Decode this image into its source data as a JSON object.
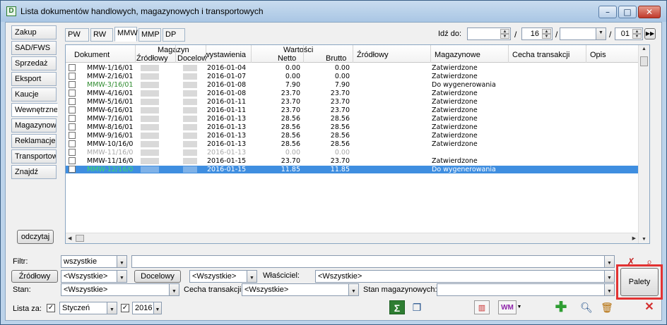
{
  "window": {
    "title": "Lista dokumentów handlowych, magazynowych i transportowych",
    "app_icon": "D"
  },
  "sidebar": {
    "items": [
      {
        "label": "Zakup"
      },
      {
        "label": "SAD/FWS"
      },
      {
        "label": "Sprzedaż"
      },
      {
        "label": "Eksport"
      },
      {
        "label": "Kaucje"
      },
      {
        "label": "Wewnętrzne"
      },
      {
        "label": "Magazynowe"
      },
      {
        "label": "Reklamacje"
      },
      {
        "label": "Transportowe"
      },
      {
        "label": "Znajdź"
      }
    ],
    "refresh_label": "odczytaj"
  },
  "tabs": [
    {
      "label": "PW"
    },
    {
      "label": "RW"
    },
    {
      "label": "MMW"
    },
    {
      "label": "MMP"
    },
    {
      "label": "DP"
    }
  ],
  "navigation": {
    "label": "Idź do:",
    "day_value": "16",
    "page_value": "01",
    "separator": "/"
  },
  "grid": {
    "headers": {
      "dokument": "Dokument",
      "magazyn_group": "Magazyn",
      "zrodlowy": "Źródłowy",
      "docelowy": "Docelow",
      "data": "Data wystawienia",
      "wartosci_group": "Wartości",
      "netto": "Netto",
      "brutto": "Brutto",
      "zrodlowy2": "Źródłowy",
      "magazynowe": "Magazynowe",
      "cecha": "Cecha transakcji",
      "opis": "Opis"
    },
    "rows": [
      {
        "doc": "MMW-1/16/01",
        "date": "2016-01-04",
        "netto": "0.00",
        "brutto": "0.00",
        "status": "Zatwierdzone",
        "color": "#000000"
      },
      {
        "doc": "MMW-2/16/01",
        "date": "2016-01-07",
        "netto": "0.00",
        "brutto": "0.00",
        "status": "Zatwierdzone",
        "color": "#000000"
      },
      {
        "doc": "MMW-3/16/01",
        "date": "2016-01-08",
        "netto": "7.90",
        "brutto": "7.90",
        "status": "Do wygenerowania",
        "color": "#2e8b2e"
      },
      {
        "doc": "MMW-4/16/01",
        "date": "2016-01-08",
        "netto": "23.70",
        "brutto": "23.70",
        "status": "Zatwierdzone",
        "color": "#000000"
      },
      {
        "doc": "MMW-5/16/01",
        "date": "2016-01-11",
        "netto": "23.70",
        "brutto": "23.70",
        "status": "Zatwierdzone",
        "color": "#000000"
      },
      {
        "doc": "MMW-6/16/01",
        "date": "2016-01-11",
        "netto": "23.70",
        "brutto": "23.70",
        "status": "Zatwierdzone",
        "color": "#000000"
      },
      {
        "doc": "MMW-7/16/01",
        "date": "2016-01-13",
        "netto": "28.56",
        "brutto": "28.56",
        "status": "Zatwierdzone",
        "color": "#000000"
      },
      {
        "doc": "MMW-8/16/01",
        "date": "2016-01-13",
        "netto": "28.56",
        "brutto": "28.56",
        "status": "Zatwierdzone",
        "color": "#000000"
      },
      {
        "doc": "MMW-9/16/01",
        "date": "2016-01-13",
        "netto": "28.56",
        "brutto": "28.56",
        "status": "Zatwierdzone",
        "color": "#000000"
      },
      {
        "doc": "MMW-10/16/01",
        "date": "2016-01-13",
        "netto": "28.56",
        "brutto": "28.56",
        "status": "Zatwierdzone",
        "color": "#000000"
      },
      {
        "doc": "MMW-11/16/01",
        "date": "2016-01-13",
        "netto": "0.00",
        "brutto": "0.00",
        "status": "",
        "color": "#a8a8a8"
      },
      {
        "doc": "MMW-11/16/01",
        "date": "2016-01-15",
        "netto": "23.70",
        "brutto": "23.70",
        "status": "Zatwierdzone",
        "color": "#000000"
      },
      {
        "doc": "MMW-12/16/01",
        "date": "2016-01-15",
        "netto": "11.85",
        "brutto": "11.85",
        "status": "Do wygenerowania",
        "color": "#3ddc6e",
        "selected": true
      }
    ]
  },
  "filters": {
    "filtr_label": "Filtr:",
    "filtr_value": "wszystkie",
    "zrodlowy_button": "Źródłowy",
    "zrodlowy_value": "<Wszystkie>",
    "docelowy_button": "Docelowy",
    "docelowy_value": "<Wszystkie>",
    "wlasciciel_label": "Właściciel:",
    "wlasciciel_value": "<Wszystkie>",
    "stan_label": "Stan:",
    "stan_value": "<Wszystkie>",
    "cecha_label": "Cecha transakcji:",
    "cecha_value": "<Wszystkie>",
    "stan_mag_label": "Stan magazynowych:",
    "stan_mag_value": "",
    "lista_label": "Lista za:",
    "month_value": "Styczeń",
    "year_value": "2016",
    "palety_button": "Palety"
  },
  "toolbar": {
    "sum_icon": "Σ",
    "wm_label": "WM"
  },
  "colors": {
    "selection": "#3f8ee0",
    "highlight_frame": "#e23232"
  }
}
